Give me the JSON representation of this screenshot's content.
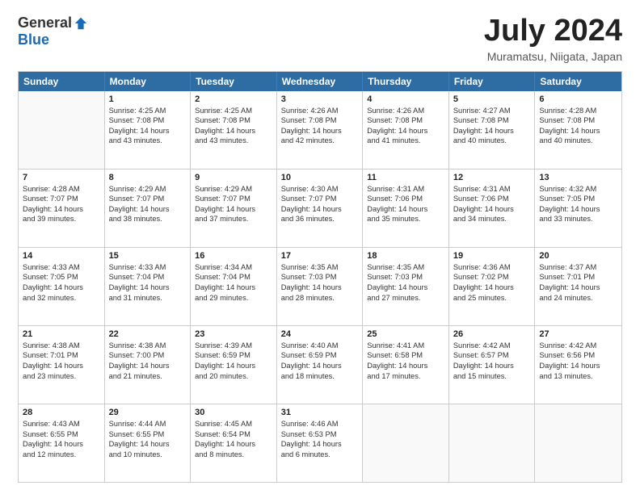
{
  "logo": {
    "general": "General",
    "blue": "Blue"
  },
  "title": "July 2024",
  "location": "Muramatsu, Niigata, Japan",
  "header_days": [
    "Sunday",
    "Monday",
    "Tuesday",
    "Wednesday",
    "Thursday",
    "Friday",
    "Saturday"
  ],
  "weeks": [
    [
      {
        "day": "",
        "lines": []
      },
      {
        "day": "1",
        "lines": [
          "Sunrise: 4:25 AM",
          "Sunset: 7:08 PM",
          "Daylight: 14 hours",
          "and 43 minutes."
        ]
      },
      {
        "day": "2",
        "lines": [
          "Sunrise: 4:25 AM",
          "Sunset: 7:08 PM",
          "Daylight: 14 hours",
          "and 43 minutes."
        ]
      },
      {
        "day": "3",
        "lines": [
          "Sunrise: 4:26 AM",
          "Sunset: 7:08 PM",
          "Daylight: 14 hours",
          "and 42 minutes."
        ]
      },
      {
        "day": "4",
        "lines": [
          "Sunrise: 4:26 AM",
          "Sunset: 7:08 PM",
          "Daylight: 14 hours",
          "and 41 minutes."
        ]
      },
      {
        "day": "5",
        "lines": [
          "Sunrise: 4:27 AM",
          "Sunset: 7:08 PM",
          "Daylight: 14 hours",
          "and 40 minutes."
        ]
      },
      {
        "day": "6",
        "lines": [
          "Sunrise: 4:28 AM",
          "Sunset: 7:08 PM",
          "Daylight: 14 hours",
          "and 40 minutes."
        ]
      }
    ],
    [
      {
        "day": "7",
        "lines": [
          "Sunrise: 4:28 AM",
          "Sunset: 7:07 PM",
          "Daylight: 14 hours",
          "and 39 minutes."
        ]
      },
      {
        "day": "8",
        "lines": [
          "Sunrise: 4:29 AM",
          "Sunset: 7:07 PM",
          "Daylight: 14 hours",
          "and 38 minutes."
        ]
      },
      {
        "day": "9",
        "lines": [
          "Sunrise: 4:29 AM",
          "Sunset: 7:07 PM",
          "Daylight: 14 hours",
          "and 37 minutes."
        ]
      },
      {
        "day": "10",
        "lines": [
          "Sunrise: 4:30 AM",
          "Sunset: 7:07 PM",
          "Daylight: 14 hours",
          "and 36 minutes."
        ]
      },
      {
        "day": "11",
        "lines": [
          "Sunrise: 4:31 AM",
          "Sunset: 7:06 PM",
          "Daylight: 14 hours",
          "and 35 minutes."
        ]
      },
      {
        "day": "12",
        "lines": [
          "Sunrise: 4:31 AM",
          "Sunset: 7:06 PM",
          "Daylight: 14 hours",
          "and 34 minutes."
        ]
      },
      {
        "day": "13",
        "lines": [
          "Sunrise: 4:32 AM",
          "Sunset: 7:05 PM",
          "Daylight: 14 hours",
          "and 33 minutes."
        ]
      }
    ],
    [
      {
        "day": "14",
        "lines": [
          "Sunrise: 4:33 AM",
          "Sunset: 7:05 PM",
          "Daylight: 14 hours",
          "and 32 minutes."
        ]
      },
      {
        "day": "15",
        "lines": [
          "Sunrise: 4:33 AM",
          "Sunset: 7:04 PM",
          "Daylight: 14 hours",
          "and 31 minutes."
        ]
      },
      {
        "day": "16",
        "lines": [
          "Sunrise: 4:34 AM",
          "Sunset: 7:04 PM",
          "Daylight: 14 hours",
          "and 29 minutes."
        ]
      },
      {
        "day": "17",
        "lines": [
          "Sunrise: 4:35 AM",
          "Sunset: 7:03 PM",
          "Daylight: 14 hours",
          "and 28 minutes."
        ]
      },
      {
        "day": "18",
        "lines": [
          "Sunrise: 4:35 AM",
          "Sunset: 7:03 PM",
          "Daylight: 14 hours",
          "and 27 minutes."
        ]
      },
      {
        "day": "19",
        "lines": [
          "Sunrise: 4:36 AM",
          "Sunset: 7:02 PM",
          "Daylight: 14 hours",
          "and 25 minutes."
        ]
      },
      {
        "day": "20",
        "lines": [
          "Sunrise: 4:37 AM",
          "Sunset: 7:01 PM",
          "Daylight: 14 hours",
          "and 24 minutes."
        ]
      }
    ],
    [
      {
        "day": "21",
        "lines": [
          "Sunrise: 4:38 AM",
          "Sunset: 7:01 PM",
          "Daylight: 14 hours",
          "and 23 minutes."
        ]
      },
      {
        "day": "22",
        "lines": [
          "Sunrise: 4:38 AM",
          "Sunset: 7:00 PM",
          "Daylight: 14 hours",
          "and 21 minutes."
        ]
      },
      {
        "day": "23",
        "lines": [
          "Sunrise: 4:39 AM",
          "Sunset: 6:59 PM",
          "Daylight: 14 hours",
          "and 20 minutes."
        ]
      },
      {
        "day": "24",
        "lines": [
          "Sunrise: 4:40 AM",
          "Sunset: 6:59 PM",
          "Daylight: 14 hours",
          "and 18 minutes."
        ]
      },
      {
        "day": "25",
        "lines": [
          "Sunrise: 4:41 AM",
          "Sunset: 6:58 PM",
          "Daylight: 14 hours",
          "and 17 minutes."
        ]
      },
      {
        "day": "26",
        "lines": [
          "Sunrise: 4:42 AM",
          "Sunset: 6:57 PM",
          "Daylight: 14 hours",
          "and 15 minutes."
        ]
      },
      {
        "day": "27",
        "lines": [
          "Sunrise: 4:42 AM",
          "Sunset: 6:56 PM",
          "Daylight: 14 hours",
          "and 13 minutes."
        ]
      }
    ],
    [
      {
        "day": "28",
        "lines": [
          "Sunrise: 4:43 AM",
          "Sunset: 6:55 PM",
          "Daylight: 14 hours",
          "and 12 minutes."
        ]
      },
      {
        "day": "29",
        "lines": [
          "Sunrise: 4:44 AM",
          "Sunset: 6:55 PM",
          "Daylight: 14 hours",
          "and 10 minutes."
        ]
      },
      {
        "day": "30",
        "lines": [
          "Sunrise: 4:45 AM",
          "Sunset: 6:54 PM",
          "Daylight: 14 hours",
          "and 8 minutes."
        ]
      },
      {
        "day": "31",
        "lines": [
          "Sunrise: 4:46 AM",
          "Sunset: 6:53 PM",
          "Daylight: 14 hours",
          "and 6 minutes."
        ]
      },
      {
        "day": "",
        "lines": []
      },
      {
        "day": "",
        "lines": []
      },
      {
        "day": "",
        "lines": []
      }
    ]
  ]
}
